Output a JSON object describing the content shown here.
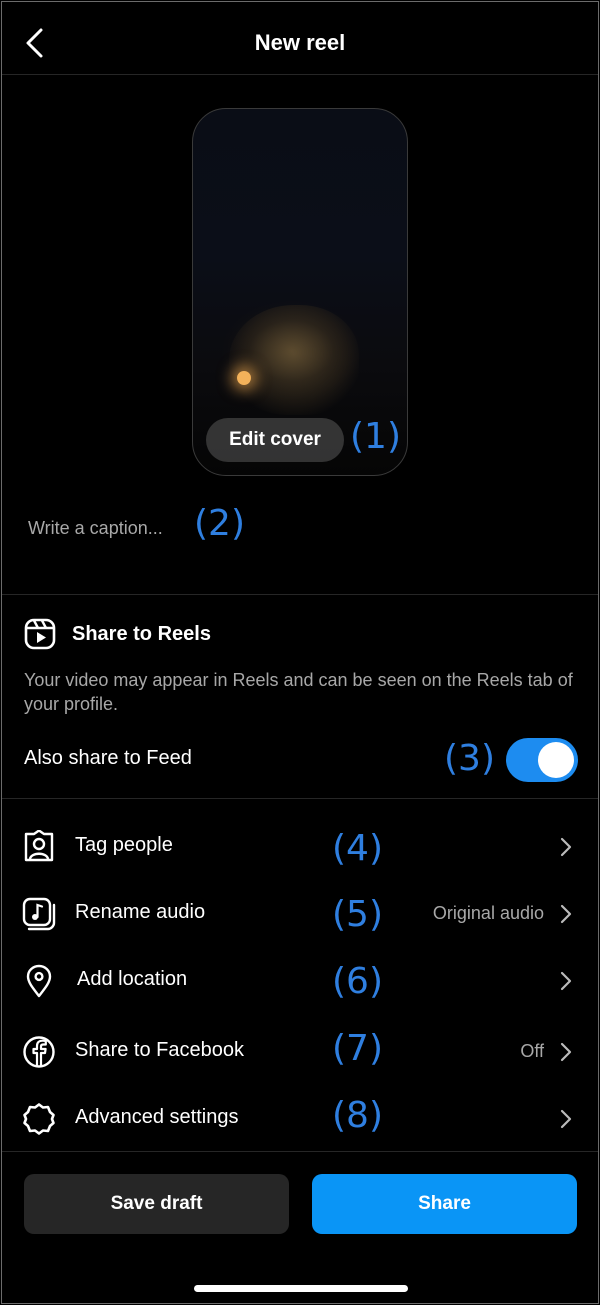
{
  "header": {
    "title": "New reel"
  },
  "preview": {
    "edit_cover_label": "Edit cover"
  },
  "caption": {
    "placeholder": "Write a caption..."
  },
  "share_to_reels": {
    "title": "Share to Reels",
    "description": "Your video may appear in Reels and can be seen on the Reels tab of your profile.",
    "also_share_label": "Also share to Feed",
    "also_share_enabled": true
  },
  "options": [
    {
      "label": "Tag people",
      "value": "",
      "icon": "tag-people-icon"
    },
    {
      "label": "Rename audio",
      "value": "Original audio",
      "icon": "audio-icon"
    },
    {
      "label": "Add location",
      "value": "",
      "icon": "location-icon"
    },
    {
      "label": "Share to Facebook",
      "value": "Off",
      "icon": "facebook-icon"
    },
    {
      "label": "Advanced settings",
      "value": "",
      "icon": "gear-icon"
    }
  ],
  "annotations": [
    "(1)",
    "(2)",
    "(3)",
    "(4)",
    "(5)",
    "(6)",
    "(7)",
    "(8)"
  ],
  "footer": {
    "save_draft_label": "Save draft",
    "share_label": "Share"
  },
  "colors": {
    "accent": "#0a95f6",
    "toggle": "#1d8cf0",
    "annotation": "#2f7fe0",
    "background": "#000000"
  }
}
